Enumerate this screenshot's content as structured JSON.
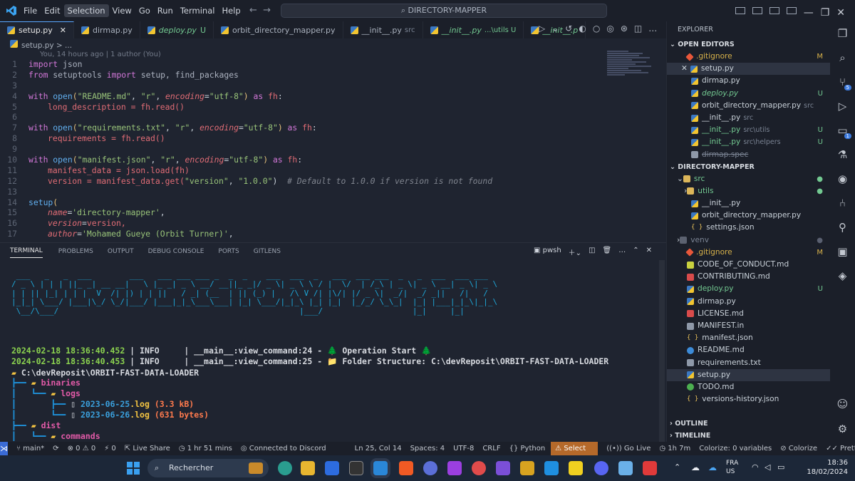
{
  "menu": [
    "File",
    "Edit",
    "Selection",
    "View",
    "Go",
    "Run",
    "Terminal",
    "Help"
  ],
  "search_box": "DIRECTORY-MAPPER",
  "tabs": [
    {
      "label": "setup.py",
      "extra": ""
    },
    {
      "label": "dirmap.py",
      "extra": ""
    },
    {
      "label": "deploy.py",
      "extra": "U"
    },
    {
      "label": "orbit_directory_mapper.py",
      "extra": ""
    },
    {
      "label": "__init__.py",
      "extra": "src"
    },
    {
      "label": "__init__.py",
      "extra": "...\\utils  U"
    },
    {
      "label": "__init__.p",
      "extra": ""
    }
  ],
  "breadcrumb": "setup.py > ...",
  "blame": "You, 14 hours ago | 1 author (You)",
  "code_lines": [
    "1",
    "2",
    "3",
    "4",
    "5",
    "6",
    "7",
    "8",
    "9",
    "10",
    "11",
    "12",
    "13",
    "14",
    "15",
    "16",
    "17"
  ],
  "code": {
    "l1": "json",
    "l2a": "setuptools",
    "l2b": "setup, find_packages",
    "l4a": "\"README.md\"",
    "l4b": "\"r\"",
    "l4c": "\"utf-8\"",
    "l5": "long_description = fh.read()",
    "l7a": "\"requirements.txt\"",
    "l7c": "\"utf-8\"",
    "l8": "requirements = fh.read()",
    "l10a": "\"manifest.json\"",
    "l10c": "\"utf-8\"",
    "l11": "manifest_data = json.load(fh)",
    "l12a": "version = manifest_data.get(",
    "l12b": "\"version\"",
    "l12c": "\"1.0.0\"",
    "l12d": "# Default to 1.0.0 if version is not found",
    "l16b": "'directory-mapper'",
    "l16d": "version,",
    "l17b": "'Mohamed Gueye (Orbit Turner)'"
  },
  "panel_tabs": [
    "TERMINAL",
    "PROBLEMS",
    "OUTPUT",
    "DEBUG CONSOLE",
    "PORTS",
    "GITLENS"
  ],
  "terminal_shell": "pwsh",
  "terminal": {
    "line1_date": "2024-02-18 18:36:40.452",
    "line1_rest": " | INFO     | __main__:view_command:24 - 🌲 Operation Start 🌲",
    "line2_date": "2024-02-18 18:36:40.453",
    "line2_rest": " | INFO     | __main__:view_command:25 - 📁 Folder Structure: C:\\devReposit\\ORBIT-FAST-DATA-LOADER",
    "root": "C:\\devReposit\\ORBIT-FAST-DATA-LOADER",
    "binaries": "binaries",
    "logs": "logs",
    "log1": "2023-06-25",
    "log1ext": ".log",
    "log1size": " (3.3 kB)",
    "log2": "2023-06-26",
    "log2ext": ".log",
    "log2size": " (631 bytes)",
    "dist": "dist",
    "commands": "commands"
  },
  "explorer": {
    "title": "EXPLORER",
    "open_editors": "OPEN EDITORS",
    "open": [
      {
        "name": ".gitignore",
        "dir": "",
        "st": "M"
      },
      {
        "name": "setup.py",
        "dir": "",
        "st": ""
      },
      {
        "name": "dirmap.py",
        "dir": "",
        "st": ""
      },
      {
        "name": "deploy.py",
        "dir": "",
        "st": "U"
      },
      {
        "name": "orbit_directory_mapper.py",
        "dir": "src",
        "st": ""
      },
      {
        "name": "__init__.py",
        "dir": "src",
        "st": ""
      },
      {
        "name": "__init__.py",
        "dir": "src\\utils",
        "st": "U"
      },
      {
        "name": "__init__.py",
        "dir": "src\\helpers",
        "st": "U"
      },
      {
        "name": "dirmap.spec",
        "dir": "",
        "st": ""
      }
    ],
    "project": "DIRECTORY-MAPPER",
    "tree": [
      {
        "name": "src",
        "st": "●"
      },
      {
        "name": "utils",
        "st": "●"
      },
      {
        "name": "__init__.py",
        "st": ""
      },
      {
        "name": "orbit_directory_mapper.py",
        "st": ""
      },
      {
        "name": "settings.json",
        "st": ""
      },
      {
        "name": "venv",
        "st": "●"
      },
      {
        "name": ".gitignore",
        "st": "M"
      },
      {
        "name": "CODE_OF_CONDUCT.md",
        "st": ""
      },
      {
        "name": "CONTRIBUTING.md",
        "st": ""
      },
      {
        "name": "deploy.py",
        "st": "U"
      },
      {
        "name": "dirmap.py",
        "st": ""
      },
      {
        "name": "LICENSE.md",
        "st": ""
      },
      {
        "name": "MANIFEST.in",
        "st": ""
      },
      {
        "name": "manifest.json",
        "st": ""
      },
      {
        "name": "README.md",
        "st": ""
      },
      {
        "name": "requirements.txt",
        "st": ""
      },
      {
        "name": "setup.py",
        "st": ""
      },
      {
        "name": "TODO.md",
        "st": ""
      },
      {
        "name": "versions-history.json",
        "st": ""
      }
    ],
    "outline": "OUTLINE",
    "timeline": "TIMELINE"
  },
  "statusbar": {
    "branch": "main*",
    "errors": "0",
    "warnings": "0",
    "ports": "0",
    "liveshare": "Live Share",
    "time": "1 hr 51 mins",
    "discord": "Connected to Discord",
    "pos": "Ln 25, Col 14",
    "spaces": "Spaces: 4",
    "enc": "UTF-8",
    "eol": "CRLF",
    "lang": "Python",
    "interp": "Select Interpreter",
    "golive": "Go Live",
    "dur": "1h 7m",
    "colorize": "Colorize: 0 variables",
    "colorize2": "Colorize",
    "prettier": "Prettier"
  },
  "taskbar": {
    "search": "Rechercher",
    "lang1": "FRA",
    "lang2": "US",
    "time": "18:36",
    "date": "18/02/2024"
  },
  "badges": {
    "scm": "5",
    "remote": "1"
  }
}
